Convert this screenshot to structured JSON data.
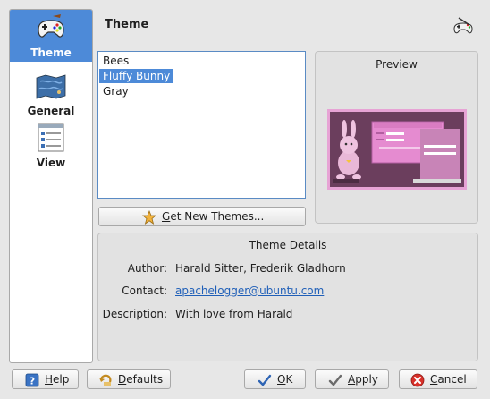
{
  "sidebar": {
    "items": [
      {
        "label": "Theme",
        "icon": "gamepad-icon",
        "active": true
      },
      {
        "label": "General",
        "icon": "map-icon",
        "active": false
      },
      {
        "label": "View",
        "icon": "checklist-icon",
        "active": false
      }
    ]
  },
  "header": {
    "title": "Theme",
    "icon": "game-settings-icon"
  },
  "themes": {
    "items": [
      "Bees",
      "Fluffy Bunny",
      "Gray"
    ],
    "selected": "Fluffy Bunny"
  },
  "get_new_themes": {
    "label_pre": "G",
    "label_post": "et New Themes...",
    "icon": "star-icon"
  },
  "preview": {
    "title": "Preview"
  },
  "details": {
    "title": "Theme Details",
    "author_label": "Author:",
    "author_value": "Harald Sitter, Frederik Gladhorn",
    "contact_label": "Contact:",
    "contact_value": "apachelogger@ubuntu.com",
    "description_label": "Description:",
    "description_value": "With love from Harald"
  },
  "buttons": {
    "help": {
      "pre": "H",
      "post": "elp",
      "icon": "help-icon"
    },
    "defaults": {
      "pre": "D",
      "post": "efaults",
      "icon": "undo-icon"
    },
    "ok": {
      "pre": "O",
      "post": "K",
      "icon": "check-icon"
    },
    "apply": {
      "pre": "A",
      "post": "pply",
      "icon": "check-icon"
    },
    "cancel": {
      "pre": "C",
      "post": "ancel",
      "icon": "cancel-icon"
    }
  },
  "colors": {
    "accent": "#4d8ad8",
    "link": "#1f5fb8",
    "preview_bg": "#6b3e5d",
    "preview_pink": "#e58bd0"
  }
}
